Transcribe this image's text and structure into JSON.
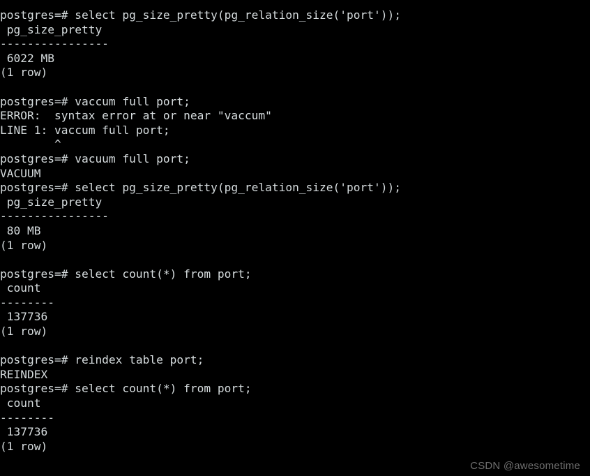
{
  "terminal": {
    "background_color": "#000000",
    "text_color": "#d6dcde",
    "prompt": "postgres=#",
    "lines": [
      "postgres=# select pg_size_pretty(pg_relation_size('port'));",
      " pg_size_pretty",
      "----------------",
      " 6022 MB",
      "(1 row)",
      "",
      "postgres=# vaccum full port;",
      "ERROR:  syntax error at or near \"vaccum\"",
      "LINE 1: vaccum full port;",
      "        ^",
      "postgres=# vacuum full port;",
      "VACUUM",
      "postgres=# select pg_size_pretty(pg_relation_size('port'));",
      " pg_size_pretty",
      "----------------",
      " 80 MB",
      "(1 row)",
      "",
      "postgres=# select count(*) from port;",
      " count",
      "--------",
      " 137736",
      "(1 row)",
      "",
      "postgres=# reindex table port;",
      "REINDEX",
      "postgres=# select count(*) from port;",
      " count",
      "--------",
      " 137736",
      "(1 row)"
    ]
  },
  "watermark": {
    "text": "CSDN @awesometime",
    "color": "#6e6e6e"
  }
}
